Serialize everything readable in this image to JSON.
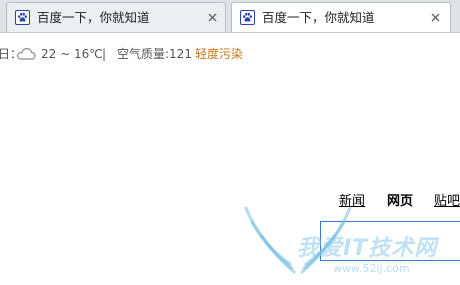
{
  "tabs": [
    {
      "title": "百度一下，你就知道",
      "favicon": "baidu-paw-icon",
      "active": false
    },
    {
      "title": "百度一下，你就知道",
      "favicon": "baidu-paw-icon",
      "active": true
    }
  ],
  "weather": {
    "date_fragment": "日：",
    "icon": "cloud-icon",
    "temperature": "22 ~ 16℃",
    "separator": "|",
    "air_quality": "空气质量:121",
    "pollution_level": "轻度污染",
    "pollution_color": "#c8761b"
  },
  "nav": {
    "news": "新闻",
    "web": "网页",
    "tieba": "贴吧"
  },
  "search": {
    "border_color": "#3b78d4"
  },
  "watermark": {
    "text": "我爱IT技术网",
    "url": "www.52ij.com"
  },
  "colors": {
    "tab_strip": "#dfe3e8",
    "tab_active": "#ffffff",
    "tab_inactive": "#eceef1",
    "favicon_blue": "#2a44a8"
  }
}
